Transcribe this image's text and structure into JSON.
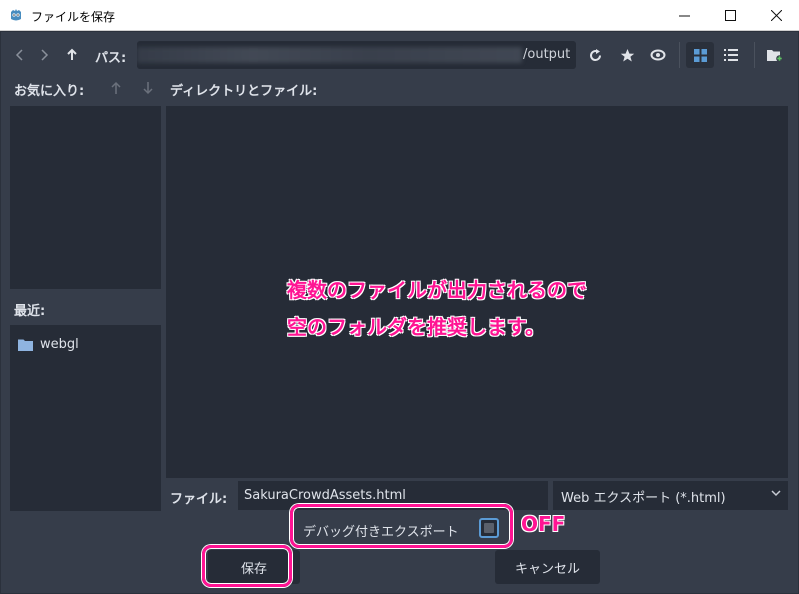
{
  "window": {
    "title": "ファイルを保存",
    "minimize_icon": "minimize-icon",
    "maximize_icon": "maximize-icon",
    "close_icon": "close-icon"
  },
  "toolbar": {
    "back_icon": "chevron-left-icon",
    "forward_icon": "chevron-right-icon",
    "up_icon": "arrow-up-icon",
    "path_label": "パス:",
    "path_value": "/output",
    "refresh_icon": "refresh-icon",
    "favorite_icon": "star-icon",
    "toggle_hidden_icon": "eye-icon",
    "grid_view_icon": "grid-view-icon",
    "list_view_icon": "list-view-icon",
    "new_folder_icon": "new-folder-icon"
  },
  "favorites": {
    "label": "お気に入り:",
    "move_up_icon": "arrow-up-icon",
    "move_down_icon": "arrow-down-icon"
  },
  "recent": {
    "label": "最近:",
    "items": [
      {
        "label": "webgl",
        "icon": "folder-icon"
      }
    ]
  },
  "main": {
    "label": "ディレクトリとファイル:"
  },
  "annotation": {
    "line1": "複数のファイルが出力されるので",
    "line2": "空のフォルダを推奨します。",
    "off": "OFF",
    "highlight_color": "#ff1493"
  },
  "file": {
    "label": "ファイル:",
    "value": "SakuraCrowdAssets.html",
    "filter_selected": "Web エクスポート (*.html)"
  },
  "debug": {
    "label": "デバッグ付きエクスポート",
    "checked": false
  },
  "buttons": {
    "save": "保存",
    "cancel": "キャンセル"
  },
  "colors": {
    "background": "#363d4a",
    "panel": "#262c37",
    "accent": "#5b9bd5"
  }
}
